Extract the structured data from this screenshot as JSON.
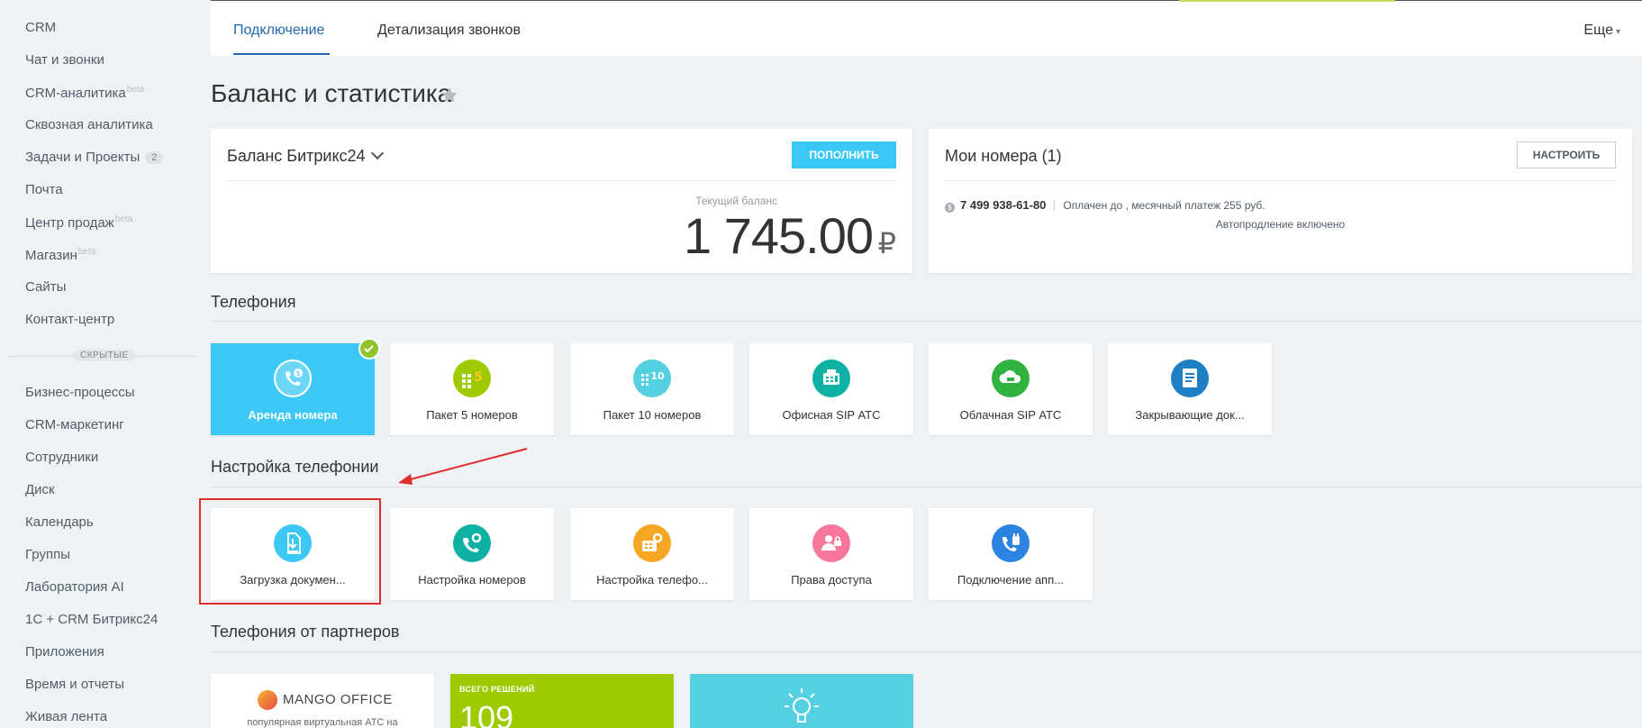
{
  "sidebar": {
    "items": [
      {
        "label": "CRM"
      },
      {
        "label": "Чат и звонки"
      },
      {
        "label": "CRM-аналитика",
        "beta": "beta"
      },
      {
        "label": "Сквозная аналитика"
      },
      {
        "label": "Задачи и Проекты",
        "count": "2"
      },
      {
        "label": "Почта"
      },
      {
        "label": "Центр продаж",
        "beta": "beta"
      },
      {
        "label": "Магазин",
        "beta": "beta"
      },
      {
        "label": "Сайты"
      },
      {
        "label": "Контакт-центр"
      }
    ],
    "hidden_label": "СКРЫТЫЕ",
    "hidden_items": [
      {
        "label": "Бизнес-процессы"
      },
      {
        "label": "CRM-маркетинг"
      },
      {
        "label": "Сотрудники"
      },
      {
        "label": "Диск"
      },
      {
        "label": "Календарь"
      },
      {
        "label": "Группы"
      },
      {
        "label": "Лаборатория AI"
      },
      {
        "label": "1С + CRM Битрикс24"
      },
      {
        "label": "Приложения"
      },
      {
        "label": "Время и отчеты"
      },
      {
        "label": "Живая лента"
      }
    ]
  },
  "tabs": [
    {
      "label": "Подключение",
      "active": true
    },
    {
      "label": "Детализация звонков",
      "active": false
    }
  ],
  "more_label": "Еще",
  "page_title": "Баланс и статистика",
  "balance": {
    "title": "Баланс Битрикс24",
    "button": "ПОПОЛНИТЬ",
    "label": "Текущий баланс",
    "value": "1 745.00",
    "currency": "₽"
  },
  "numbers": {
    "title": "Мои номера (1)",
    "button": "НАСТРОИТЬ",
    "phone": "7 499 938-61-80",
    "paid": "Оплачен до , месячный платеж 255 руб.",
    "autoprolong": "Автопродление включено"
  },
  "telephony": {
    "title": "Телефония",
    "tiles": [
      {
        "label": "Аренда номера",
        "icon": "phone-money-icon"
      },
      {
        "label": "Пакет 5 номеров",
        "icon": "pack-5-icon",
        "badge": "5"
      },
      {
        "label": "Пакет 10 номеров",
        "icon": "pack-10-icon",
        "badge": "10"
      },
      {
        "label": "Офисная SIP АТС",
        "icon": "office-sip-icon"
      },
      {
        "label": "Облачная SIP АТС",
        "icon": "cloud-sip-icon"
      },
      {
        "label": "Закрывающие док...",
        "icon": "documents-icon"
      }
    ]
  },
  "telephony_settings": {
    "title": "Настройка телефонии",
    "tiles": [
      {
        "label": "Загрузка докумен...",
        "icon": "document-upload-icon"
      },
      {
        "label": "Настройка номеров",
        "icon": "phone-settings-icon"
      },
      {
        "label": "Настройка телефо...",
        "icon": "telephony-settings-icon"
      },
      {
        "label": "Права доступа",
        "icon": "access-rights-icon"
      },
      {
        "label": "Подключение апп...",
        "icon": "device-connect-icon"
      }
    ]
  },
  "partners": {
    "title": "Телефония от партнеров",
    "mango_name": "MANGO OFFICE",
    "mango_desc": "популярная виртуальная АТС на",
    "solutions_label": "ВСЕГО РЕШЕНИЙ",
    "solutions_count": "109"
  },
  "colors": {
    "accent_blue": "#2067b0",
    "button_blue": "#3bc8f5",
    "highlight_red": "#e22b2b",
    "partner_green": "#9dcb00",
    "partner_teal": "#55d0e0"
  }
}
